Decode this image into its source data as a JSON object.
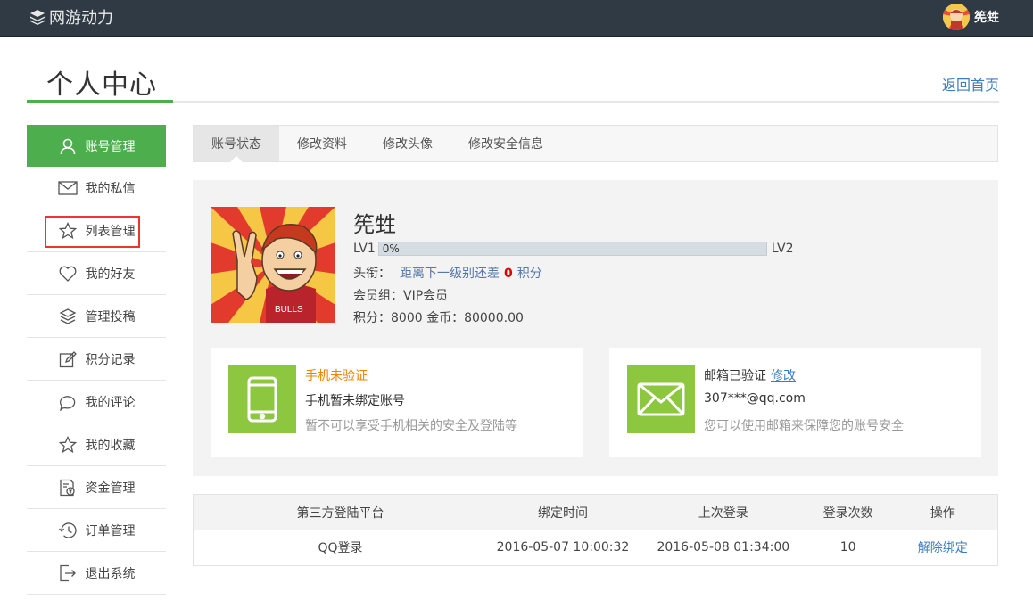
{
  "app": {
    "brand": "网游动力",
    "username": "筅甡"
  },
  "header": {
    "title": "个人中心",
    "back_link": "返回首页"
  },
  "sidebar": {
    "items": [
      {
        "label": "账号管理",
        "icon": "user-icon",
        "active": true
      },
      {
        "label": "我的私信",
        "icon": "mail-icon"
      },
      {
        "label": "列表管理",
        "icon": "star-icon",
        "highlighted": true
      },
      {
        "label": "我的好友",
        "icon": "heart-icon"
      },
      {
        "label": "管理投稿",
        "icon": "layers-icon"
      },
      {
        "label": "积分记录",
        "icon": "edit-icon"
      },
      {
        "label": "我的评论",
        "icon": "comment-icon"
      },
      {
        "label": "我的收藏",
        "icon": "star-icon"
      },
      {
        "label": "资金管理",
        "icon": "finance-doc-icon"
      },
      {
        "label": "订单管理",
        "icon": "history-icon"
      },
      {
        "label": "退出系统",
        "icon": "logout-icon"
      }
    ]
  },
  "tabs": [
    {
      "label": "账号状态",
      "active": true
    },
    {
      "label": "修改资料"
    },
    {
      "label": "修改头像"
    },
    {
      "label": "修改安全信息"
    }
  ],
  "profile": {
    "name": "筅甡",
    "level_from": "LV1",
    "level_to": "LV2",
    "progress_text": "0%",
    "progress": 0,
    "title_label": "头衔：",
    "title_text_before": "距离下一级别还差",
    "title_gap_value": "0",
    "title_text_after": "积分",
    "group": "会员组：VIP会员",
    "points": "积分：8000 金币：80000.00"
  },
  "verify": {
    "phone": {
      "status": "手机未验证",
      "line": "手机暂未绑定账号",
      "sub": "暂不可以享受手机相关的安全及登陆等"
    },
    "email": {
      "status": "邮箱已验证",
      "edit_link": "修改",
      "line": "307***@qq.com",
      "sub": "您可以使用邮箱来保障您的账号安全"
    }
  },
  "bind_table": {
    "headers": [
      "第三方登陆平台",
      "绑定时间",
      "上次登录",
      "登录次数",
      "操作"
    ],
    "rows": [
      {
        "platform": "QQ登录",
        "bind_time": "2016-05-07 10:00:32",
        "last_login": "2016-05-08 01:34:00",
        "count": "10",
        "action": "解除绑定"
      }
    ]
  },
  "colors": {
    "accent": "#4cae4c",
    "topbar": "#2f3a44",
    "link": "#3c7dbf",
    "verify_icon_bg": "#8dc63f",
    "warning": "#f08300",
    "highlight": "#ee3333"
  }
}
